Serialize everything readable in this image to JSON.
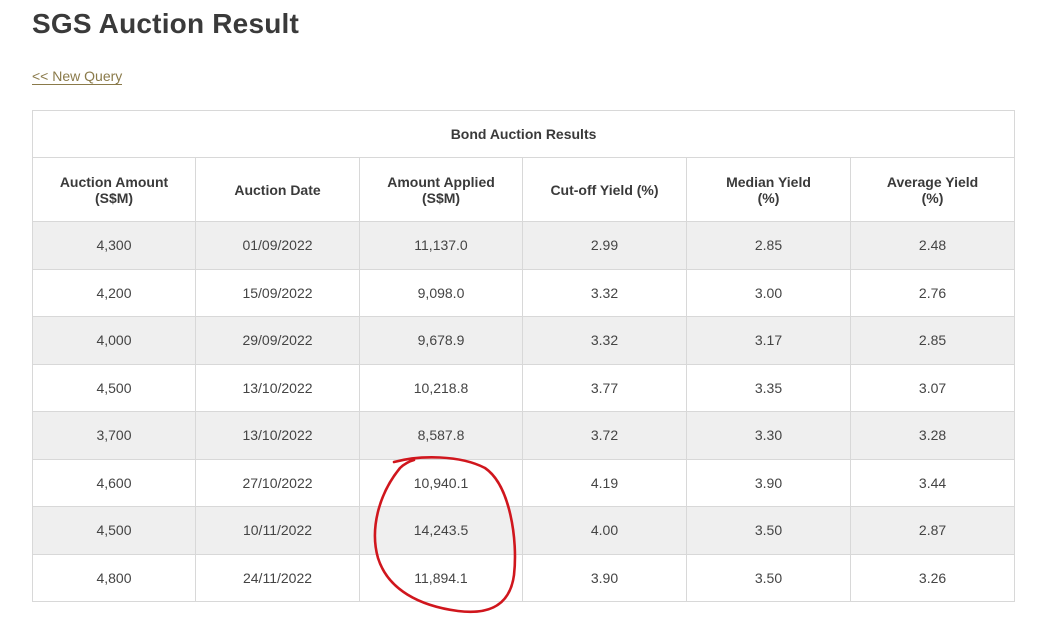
{
  "page": {
    "title": "SGS Auction Result",
    "back_link": "<< New Query"
  },
  "table": {
    "caption": "Bond Auction Results",
    "columns": [
      "Auction Amount (S$M)",
      "Auction Date",
      "Amount Applied (S$M)",
      "Cut-off Yield (%)",
      "Median Yield (%)",
      "Average Yield (%)"
    ],
    "rows": [
      [
        "4,300",
        "01/09/2022",
        "11,137.0",
        "2.99",
        "2.85",
        "2.48"
      ],
      [
        "4,200",
        "15/09/2022",
        "9,098.0",
        "3.32",
        "3.00",
        "2.76"
      ],
      [
        "4,000",
        "29/09/2022",
        "9,678.9",
        "3.32",
        "3.17",
        "2.85"
      ],
      [
        "4,500",
        "13/10/2022",
        "10,218.8",
        "3.77",
        "3.35",
        "3.07"
      ],
      [
        "3,700",
        "13/10/2022",
        "8,587.8",
        "3.72",
        "3.30",
        "3.28"
      ],
      [
        "4,600",
        "27/10/2022",
        "10,940.1",
        "4.19",
        "3.90",
        "3.44"
      ],
      [
        "4,500",
        "10/11/2022",
        "14,243.5",
        "4.00",
        "3.50",
        "2.87"
      ],
      [
        "4,800",
        "24/11/2022",
        "11,894.1",
        "3.90",
        "3.50",
        "3.26"
      ]
    ]
  },
  "colors": {
    "link": "#8a7a4a",
    "stripe": "#efefef",
    "annotation": "#d0161d"
  }
}
